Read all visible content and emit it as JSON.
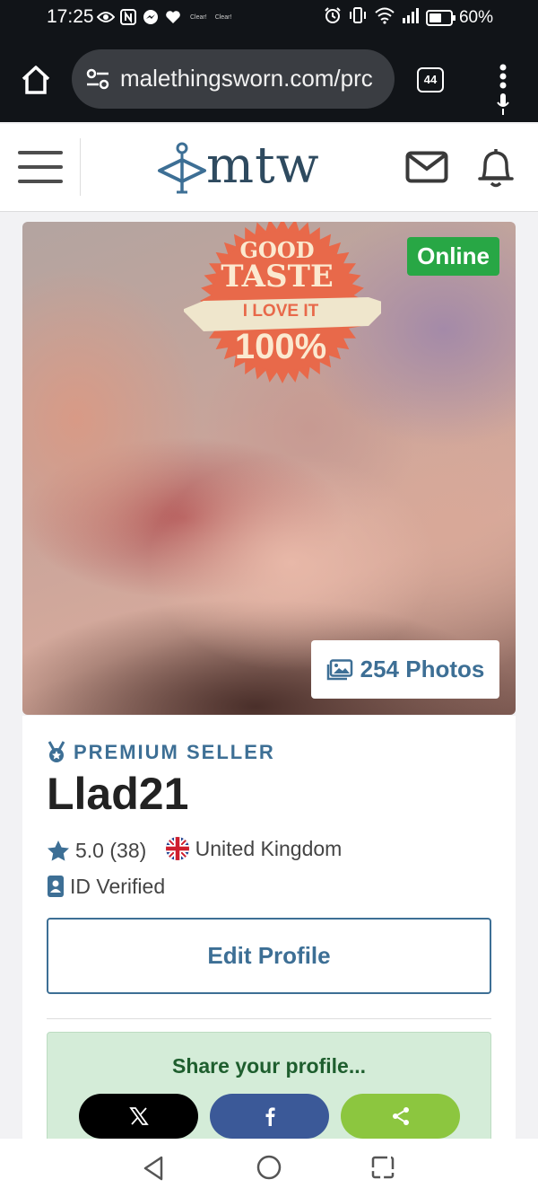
{
  "status_bar": {
    "time": "17:25",
    "small_labels": [
      "Clear!",
      "Clear!"
    ],
    "battery": "60%",
    "battery_level": 0.6
  },
  "browser": {
    "url": "malethingsworn.com/prc",
    "tab_count": "44"
  },
  "header": {
    "logo_text": "mtw"
  },
  "photo": {
    "sticker": {
      "line1": "GOOD",
      "line2": "TASTE",
      "ribbon": "I LOVE IT",
      "line3": "100%"
    },
    "online_label": "Online",
    "photos_count_label": "254 Photos"
  },
  "profile": {
    "premium_label": "PREMIUM SELLER",
    "username": "Llad21",
    "rating": "5.0 (38)",
    "country": "United Kingdom",
    "id_verified": "ID Verified",
    "edit_button": "Edit Profile",
    "share_title": "Share your profile..."
  },
  "colors": {
    "accent": "#3d6f95",
    "online": "#28a745",
    "share_bg": "#d4ecd8",
    "share_x": "#000000",
    "share_fb": "#3b5998",
    "share_generic": "#8cc63f"
  },
  "icons": {
    "status_left": [
      "eye-icon",
      "nfc-icon",
      "messenger-icon",
      "heart-icon"
    ],
    "status_right": [
      "alarm-icon",
      "vibrate-icon",
      "wifi-icon",
      "signal-icon",
      "battery-icon"
    ],
    "share": [
      "x-logo-icon",
      "facebook-icon",
      "share-icon"
    ],
    "nav": [
      "back-icon",
      "home-icon",
      "recent-apps-icon"
    ]
  }
}
